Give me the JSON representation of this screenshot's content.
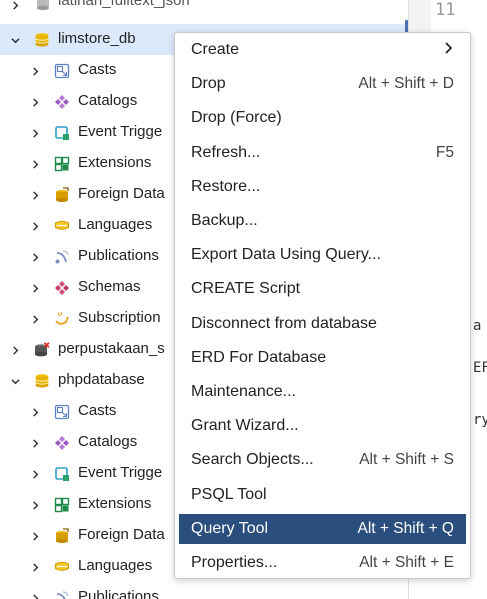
{
  "tree": {
    "top_partial_label": "latihan_fulltext_json",
    "items": [
      {
        "label": "limstore_db",
        "icon": "database-icon",
        "expanded": true,
        "selected": true
      },
      {
        "label": "Casts",
        "icon": "casts-icon"
      },
      {
        "label": "Catalogs",
        "icon": "catalogs-icon"
      },
      {
        "label": "Event Trigge",
        "icon": "event-trigger-icon"
      },
      {
        "label": "Extensions",
        "icon": "extensions-icon"
      },
      {
        "label": "Foreign Data",
        "icon": "foreign-data-icon"
      },
      {
        "label": "Languages",
        "icon": "languages-icon"
      },
      {
        "label": "Publications",
        "icon": "publications-icon"
      },
      {
        "label": "Schemas",
        "icon": "schemas-icon"
      },
      {
        "label": "Subscription",
        "icon": "subscriptions-icon"
      },
      {
        "label": "perpustakaan_s",
        "icon": "database-disconnected-icon"
      },
      {
        "label": "phpdatabase",
        "icon": "database-icon",
        "expanded": true
      },
      {
        "label": "Casts",
        "icon": "casts-icon"
      },
      {
        "label": "Catalogs",
        "icon": "catalogs-icon"
      },
      {
        "label": "Event Trigge",
        "icon": "event-trigger-icon"
      },
      {
        "label": "Extensions",
        "icon": "extensions-icon"
      },
      {
        "label": "Foreign Data",
        "icon": "foreign-data-icon"
      },
      {
        "label": "Languages",
        "icon": "languages-icon"
      },
      {
        "label": "Publications",
        "icon": "publications-icon"
      }
    ]
  },
  "editor": {
    "line_number": "11",
    "fragments": [
      "a (",
      "EF",
      "ry"
    ]
  },
  "context_menu": {
    "items": [
      {
        "label": "Create",
        "shortcut": "",
        "submenu": true
      },
      {
        "label": "Drop",
        "shortcut": "Alt + Shift + D"
      },
      {
        "label": "Drop (Force)",
        "shortcut": ""
      },
      {
        "label": "Refresh...",
        "shortcut": "F5"
      },
      {
        "label": "Restore...",
        "shortcut": ""
      },
      {
        "label": "Backup...",
        "shortcut": ""
      },
      {
        "label": "Export Data Using Query...",
        "shortcut": ""
      },
      {
        "label": "CREATE Script",
        "shortcut": ""
      },
      {
        "label": "Disconnect from database",
        "shortcut": ""
      },
      {
        "label": "ERD For Database",
        "shortcut": ""
      },
      {
        "label": "Maintenance...",
        "shortcut": ""
      },
      {
        "label": "Grant Wizard...",
        "shortcut": ""
      },
      {
        "label": "Search Objects...",
        "shortcut": "Alt + Shift + S"
      },
      {
        "label": "PSQL Tool",
        "shortcut": ""
      },
      {
        "label": "Query Tool",
        "shortcut": "Alt + Shift + Q",
        "active": true
      },
      {
        "label": "Properties...",
        "shortcut": "Alt + Shift + E"
      }
    ]
  },
  "colors": {
    "selection_bg": "#dbe9fb",
    "menu_active_bg": "#2a4f7e",
    "database_icon": "#e8b200"
  }
}
